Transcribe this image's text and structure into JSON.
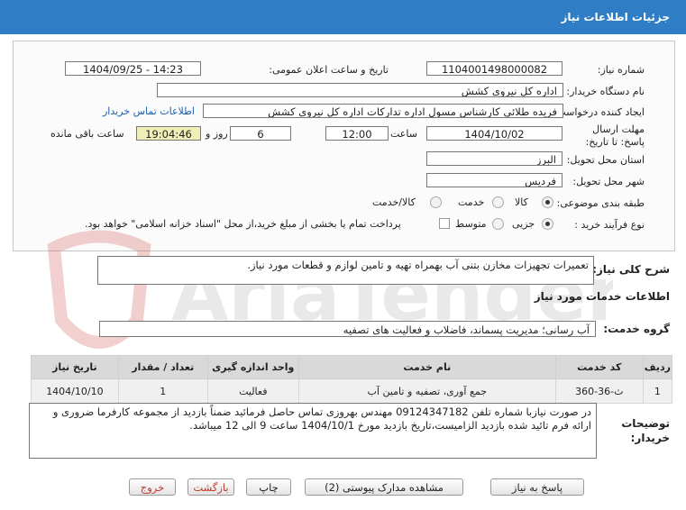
{
  "header": {
    "title": "جزئیات اطلاعات نیاز"
  },
  "form": {
    "need_number_label": "شماره نیاز:",
    "need_number": "1104001498000082",
    "announce_label": "تاریخ و ساعت اعلان عمومی:",
    "announce_value": "1404/09/25 - 14:23",
    "buyer_org_label": "نام دستگاه خریدار:",
    "buyer_org": "اداره کل نیروی کشش",
    "creator_label": "ایجاد کننده درخواست:",
    "creator": "فریده طلائی کارشناس مسول اداره تدارکات اداره کل نیروی کشش",
    "contact_link": "اطلاعات تماس خریدار",
    "deadline_label": "مهلت ارسال پاسخ: تا تاریخ:",
    "deadline_date": "1404/10/02",
    "time_label": "ساعت",
    "deadline_time": "12:00",
    "days_value": "6",
    "days_label": "روز و",
    "remaining_value": "19:04:46",
    "remaining_label": "ساعت باقی مانده",
    "province_label": "استان محل تحویل:",
    "province": "البرز",
    "city_label": "شهر محل تحویل:",
    "city": "فردیس",
    "category_label": "طبقه بندی موضوعی:",
    "category_options": [
      "کالا",
      "خدمت",
      "کالا/خدمت"
    ],
    "category_selected": "خدمت",
    "purchase_type_label": "نوع فرآیند خرید :",
    "purchase_options": [
      "جزیی",
      "متوسط"
    ],
    "purchase_selected": "جزیی",
    "payment_note": "پرداخت تمام یا بخشی از مبلغ خرید،از محل \"اسناد خزانه اسلامی\" خواهد بود."
  },
  "summary": {
    "label": "شرح کلی نیاز:",
    "text": "تعمیرات تجهیزات مخازن بتنی آب بهمراه تهیه و تامین لوازم و قطعات مورد نیاز."
  },
  "services": {
    "section_title": "اطلاعات خدمات مورد نیاز",
    "group_label": "گروه خدمت:",
    "group_value": "آب رسانی؛ مدیریت پسماند، فاضلاب و فعالیت های تصفیه",
    "columns": [
      "ردیف",
      "کد خدمت",
      "نام خدمت",
      "واحد اندازه گیری",
      "تعداد / مقدار",
      "تاریخ نیاز"
    ],
    "rows": [
      [
        "1",
        "ث-36-360",
        "جمع آوری، تصفیه و تامین آب",
        "فعالیت",
        "1",
        "1404/10/10"
      ]
    ]
  },
  "buyer_notes": {
    "label": "توضیحات خریدار:",
    "text": "در صورت نیازبا شماره تلفن 09124347182 مهندس بهروزی تماس حاصل فرمائید ضمناً بازدید از مجموعه کارفرما ضروری و ارائه فرم تائید شده بازدید الزامیست،تاریخ بازدید مورخ 1404/10/1 ساعت 9 الی 12 میباشد."
  },
  "buttons": {
    "reply": "پاسخ به نیاز",
    "docs": "مشاهده مدارک پیوستی (2)",
    "print": "چاپ",
    "back": "بازگشت",
    "exit": "خروج"
  },
  "watermark": {
    "text": "AriaTender.net"
  },
  "colors": {
    "header": "#2f7dc4",
    "remaining_bg": "#f0efb8",
    "link": "#1a5fb4",
    "exit_text": "#c0392b"
  }
}
